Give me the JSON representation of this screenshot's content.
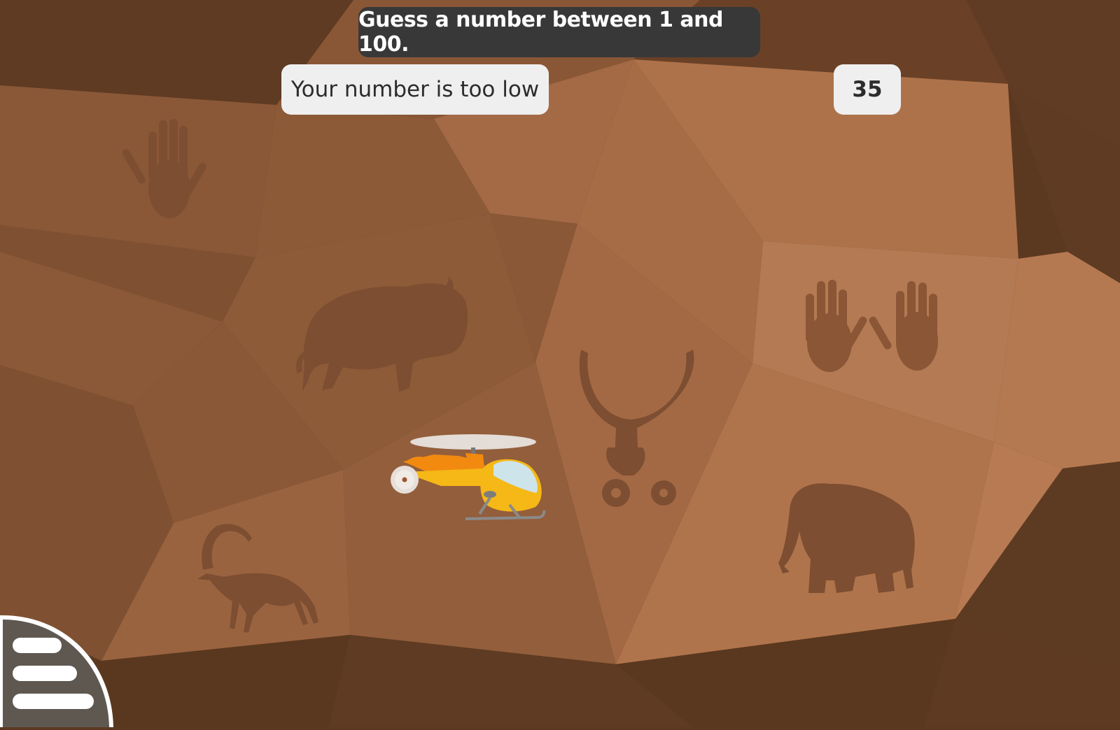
{
  "game": {
    "instruction": "Guess a number between 1 and 100.",
    "feedback": "Your number is too low",
    "guess_value": "35"
  },
  "icons": {
    "menu": "menu-icon",
    "helicopter": "helicopter-icon",
    "paintings": [
      "handprint-icon",
      "bison-icon",
      "antlered-figure-icon",
      "two-handprints-icon",
      "ibex-icon",
      "elephant-icon"
    ]
  },
  "colors": {
    "cave_dark": "#5b3920",
    "cave_light": "#b87c55",
    "painting": "#7d4e31",
    "instruction_bg": "#383838",
    "bubble_bg": "#efefef",
    "helicopter_body": "#f5b817",
    "helicopter_accent": "#f28a10"
  }
}
